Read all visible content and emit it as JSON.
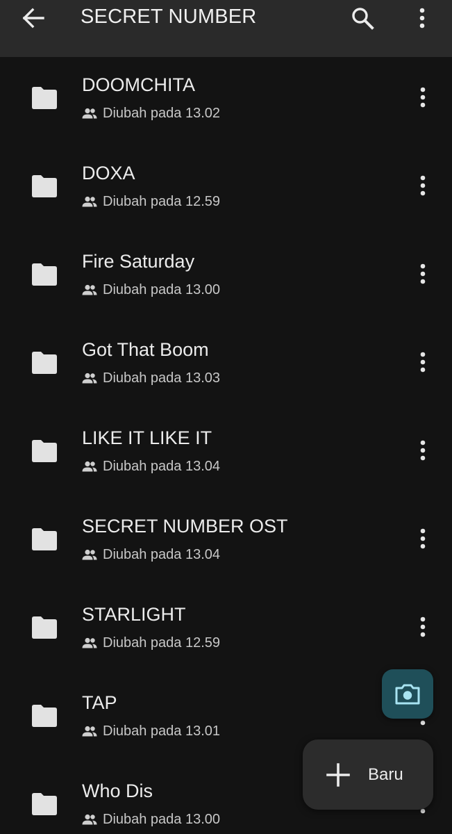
{
  "header": {
    "title": "SECRET NUMBER",
    "back_icon": "arrow-back-icon",
    "search_icon": "search-icon",
    "more_icon": "more-vert-icon"
  },
  "folders": [
    {
      "name": "DOOMCHITA",
      "modified": "Diubah pada 13.02"
    },
    {
      "name": "DOXA",
      "modified": "Diubah pada 12.59"
    },
    {
      "name": "Fire Saturday",
      "modified": "Diubah pada 13.00"
    },
    {
      "name": "Got That Boom",
      "modified": "Diubah pada 13.03"
    },
    {
      "name": "LIKE IT LIKE IT",
      "modified": "Diubah pada 13.04"
    },
    {
      "name": "SECRET NUMBER OST",
      "modified": "Diubah pada 13.04"
    },
    {
      "name": "STARLIGHT",
      "modified": "Diubah pada 12.59"
    },
    {
      "name": "TAP",
      "modified": "Diubah pada 13.01"
    },
    {
      "name": "Who Dis",
      "modified": "Diubah pada 13.00"
    }
  ],
  "fab": {
    "new_label": "Baru",
    "camera_icon": "camera-icon",
    "plus_icon": "plus-icon"
  },
  "colors": {
    "background": "#131313",
    "topbar": "#2a2a2a",
    "camera_fab": "#1f4f59",
    "camera_accent": "#a8e4f2",
    "new_fab": "#2c2c2c"
  }
}
